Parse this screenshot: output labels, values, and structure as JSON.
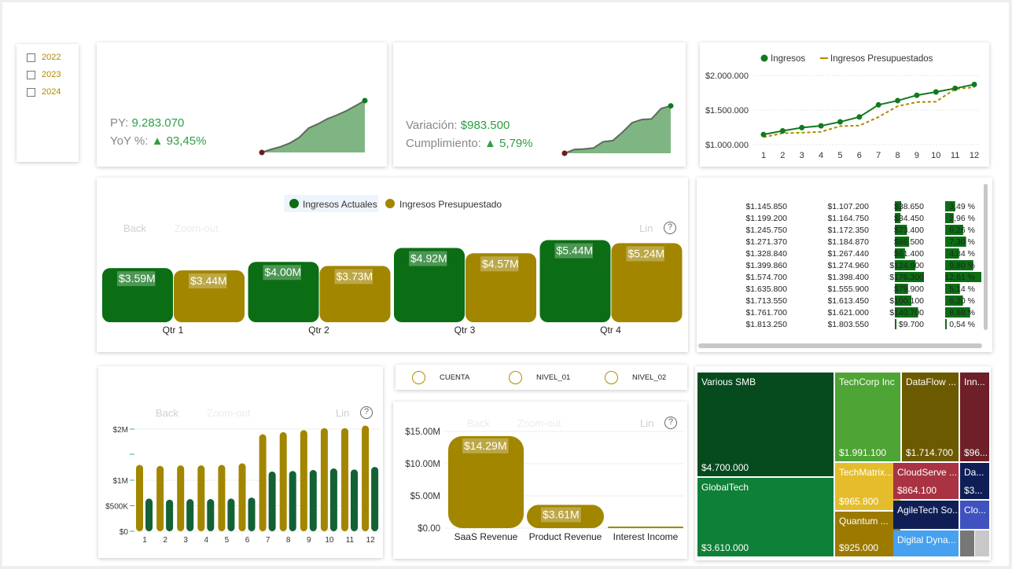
{
  "slicer": {
    "years": [
      "2022",
      "2023",
      "2024"
    ]
  },
  "kpi1": {
    "py_label": "PY:",
    "py_value": "9.283.070",
    "yoy_label": "YoY %:",
    "yoy_value": "▲ 93,45%"
  },
  "kpi2": {
    "var_label": "Variación:",
    "var_value": "$983.500",
    "cum_label": "Cumplimiento:",
    "cum_value": "▲ 5,79%"
  },
  "line_chart": {
    "legend_actual": "Ingresos",
    "legend_budget": "Ingresos Presupuestados",
    "y_ticks": [
      "$2.000.000",
      "$1.500.000",
      "$1.000.000"
    ],
    "x_ticks": [
      "1",
      "2",
      "3",
      "4",
      "5",
      "6",
      "7",
      "8",
      "9",
      "10",
      "11",
      "12"
    ]
  },
  "qtr_chart": {
    "legend_actual": "Ingresos Actuales",
    "legend_budget": "Ingresos Presupuestado",
    "toolbar": {
      "back": "Back",
      "zoom_out": "Zoom-out",
      "lin": "Lin",
      "help": "?"
    }
  },
  "table": {
    "rows": [
      [
        "$1.145.850",
        "$1.107.200",
        "$38.650",
        "3,49 %"
      ],
      [
        "$1.199.200",
        "$1.164.750",
        "$34.450",
        "2,96 %"
      ],
      [
        "$1.245.750",
        "$1.172.350",
        "$73.400",
        "6,26 %"
      ],
      [
        "$1.271.370",
        "$1.184.870",
        "$86.500",
        "7,30 %"
      ],
      [
        "$1.328.840",
        "$1.267.440",
        "$61.400",
        "4,84 %"
      ],
      [
        "$1.399.860",
        "$1.274.960",
        "$124.900",
        "9,80 %"
      ],
      [
        "$1.574.700",
        "$1.398.400",
        "$176.300",
        "12,61 %"
      ],
      [
        "$1.635.800",
        "$1.555.900",
        "$79.900",
        "5,14 %"
      ],
      [
        "$1.713.550",
        "$1.613.450",
        "$100.100",
        "6,20 %"
      ],
      [
        "$1.761.700",
        "$1.621.000",
        "$140.700",
        "8,68 %"
      ],
      [
        "$1.813.250",
        "$1.803.550",
        "$9.700",
        "0,54 %"
      ]
    ]
  },
  "monthly_chart": {
    "toolbar": {
      "back": "Back",
      "zoom_out": "Zoom-out",
      "lin": "Lin",
      "help": "?"
    },
    "y_ticks": [
      "$2M",
      "$1M",
      "$500K",
      "$0"
    ],
    "x_ticks": [
      "1",
      "2",
      "3",
      "4",
      "5",
      "6",
      "7",
      "8",
      "9",
      "10",
      "11",
      "12"
    ]
  },
  "radio": {
    "options": [
      "CUENTA",
      "NIVEL_01",
      "NIVEL_02"
    ]
  },
  "revenue_chart": {
    "toolbar": {
      "back": "Back",
      "zoom_out": "Zoom-out",
      "lin": "Lin",
      "help": "?"
    },
    "y_ticks": [
      "$15.00M",
      "$10.00M",
      "$5.00M",
      "$0.00"
    ]
  },
  "treemap": {
    "tiles": [
      {
        "name": "Various SMB",
        "value": "$4.700.000",
        "color": "#064b1e"
      },
      {
        "name": "TechCorp Inc",
        "value": "$1.991.100",
        "color": "#4ea435"
      },
      {
        "name": "DataFlow ...",
        "value": "$1.714.700",
        "color": "#6b5a00"
      },
      {
        "name": "Inn...",
        "value": "$96...",
        "color": "#6e1f27"
      },
      {
        "name": "GlobalTech",
        "value": "$3.610.000",
        "color": "#0e8037"
      },
      {
        "name": "TechMatrix...",
        "value": "$965.800",
        "color": "#e5bd2c"
      },
      {
        "name": "CloudServe ...",
        "value": "$864.100",
        "color": "#a93343"
      },
      {
        "name": "Da...",
        "value": "$3...",
        "color": "#0f1f56"
      },
      {
        "name": "Quantum ...",
        "value": "$925.000",
        "color": "#9c7a00"
      },
      {
        "name": "AgileTech So...",
        "value": "",
        "color": "#0f1f56"
      },
      {
        "name": "Clo...",
        "value": "",
        "color": "#3f52bf"
      },
      {
        "name": "Digital Dyna...",
        "value": "",
        "color": "#46a1f0"
      }
    ]
  },
  "chart_data": [
    {
      "type": "area",
      "title": "",
      "x": [
        1,
        2,
        3,
        4,
        5,
        6,
        7,
        8,
        9,
        10,
        11,
        12
      ],
      "values": [
        0,
        0.06,
        0.11,
        0.18,
        0.29,
        0.47,
        0.55,
        0.65,
        0.72,
        0.8,
        0.9,
        1.0
      ]
    },
    {
      "type": "area",
      "title": "",
      "x": [
        1,
        2,
        3,
        4,
        5,
        6,
        7,
        8,
        9,
        10,
        11,
        12
      ],
      "values": [
        0,
        0.07,
        0.08,
        0.1,
        0.22,
        0.24,
        0.4,
        0.58,
        0.64,
        0.65,
        0.85,
        0.9
      ]
    },
    {
      "type": "line",
      "x": [
        1,
        2,
        3,
        4,
        5,
        6,
        7,
        8,
        9,
        10,
        11,
        12
      ],
      "ylim": [
        1000000,
        2000000
      ],
      "series": [
        {
          "name": "Ingresos",
          "values": [
            1145850,
            1199200,
            1245750,
            1271370,
            1328840,
            1399860,
            1574700,
            1635800,
            1713550,
            1761700,
            1813250,
            1870000
          ],
          "color": "#0f7a1e"
        },
        {
          "name": "Ingresos Presupuestados",
          "values": [
            1107200,
            1164750,
            1172350,
            1184870,
            1267440,
            1274960,
            1398400,
            1555900,
            1613450,
            1621000,
            1803550,
            1830000
          ],
          "color": "#b08a00"
        }
      ]
    },
    {
      "type": "bar",
      "categories": [
        "Qtr 1",
        "Qtr 2",
        "Qtr 3",
        "Qtr 4"
      ],
      "series": [
        {
          "name": "Ingresos Actuales",
          "values": [
            3.59,
            4.0,
            4.92,
            5.44
          ],
          "labels": [
            "$3.59M",
            "$4.00M",
            "$4.92M",
            "$5.44M"
          ],
          "color": "#0b6e14"
        },
        {
          "name": "Ingresos Presupuestado",
          "values": [
            3.44,
            3.73,
            4.57,
            5.24
          ],
          "labels": [
            "$3.44M",
            "$3.73M",
            "$4.57M",
            "$5.24M"
          ],
          "color": "#a28600"
        }
      ]
    },
    {
      "type": "bar",
      "categories": [
        "1",
        "2",
        "3",
        "4",
        "5",
        "6",
        "7",
        "8",
        "9",
        "10",
        "11",
        "12"
      ],
      "series": [
        {
          "values": [
            1.3,
            1.28,
            1.29,
            1.29,
            1.3,
            1.33,
            1.9,
            1.94,
            1.98,
            2.02,
            2.02,
            2.07
          ],
          "color": "#a28600"
        },
        {
          "values": [
            0.64,
            0.62,
            0.63,
            0.63,
            0.64,
            0.66,
            1.17,
            1.18,
            1.2,
            1.23,
            1.21,
            1.26
          ],
          "color": "#136236"
        }
      ],
      "ylim": [
        0,
        2.2
      ]
    },
    {
      "type": "bar",
      "categories": [
        "SaaS Revenue",
        "Product Revenue",
        "Interest Income"
      ],
      "values": [
        14.29,
        3.61,
        0.12
      ],
      "labels": [
        "$14.29M",
        "$3.61M",
        ""
      ],
      "ylim": [
        0,
        17
      ]
    }
  ]
}
